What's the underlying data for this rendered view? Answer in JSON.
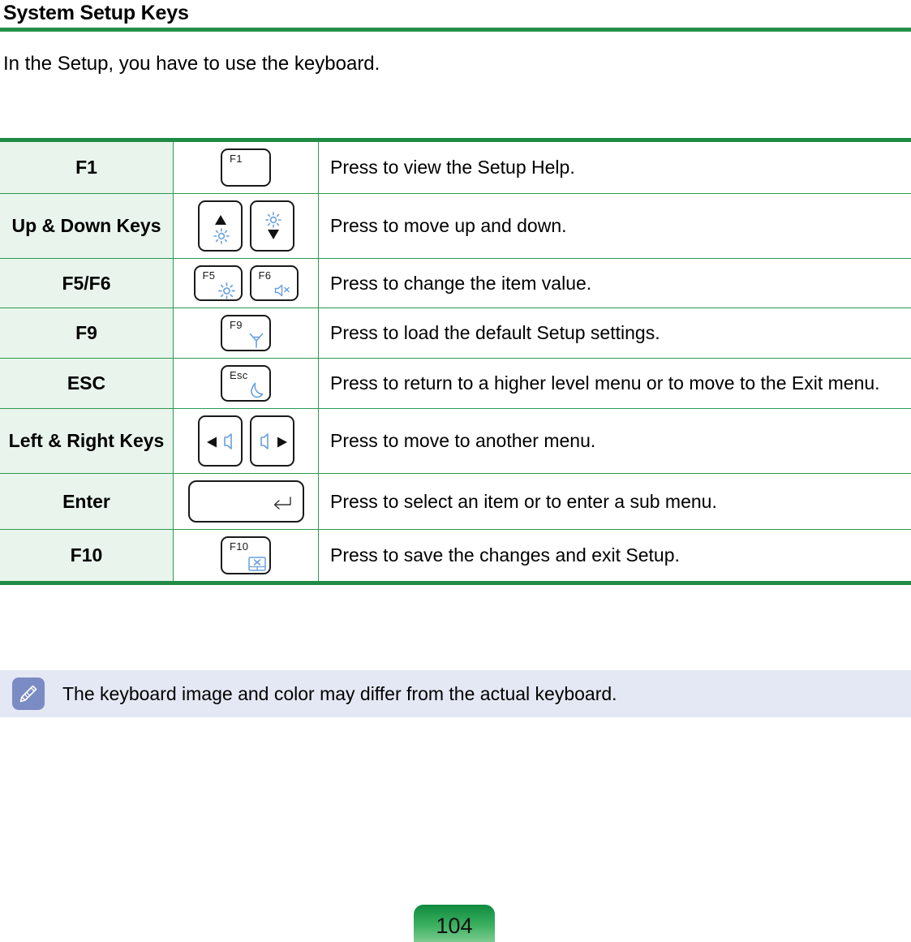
{
  "header": {
    "title": "System Setup Keys",
    "rule_color": "#239048"
  },
  "intro": {
    "text": "In the Setup, you have to use the keyboard."
  },
  "table": {
    "border_color": "#2c9a4f",
    "name_column_bg": "#e9f4ec",
    "rows": [
      {
        "name": "F1",
        "keycaps": [
          {
            "label": "F1",
            "glyph": "none"
          }
        ],
        "description": "Press to view the Setup Help."
      },
      {
        "name": "Up & Down Keys",
        "keycaps": [
          {
            "label": "",
            "glyph": "arrow-up-brightness-up"
          },
          {
            "label": "",
            "glyph": "arrow-down-brightness-down"
          }
        ],
        "description": "Press to move up and down."
      },
      {
        "name": "F5/F6",
        "keycaps": [
          {
            "label": "F5",
            "glyph": "brightness-icon"
          },
          {
            "label": "F6",
            "glyph": "speaker-mute-icon"
          }
        ],
        "description": "Press to change the item value."
      },
      {
        "name": "F9",
        "keycaps": [
          {
            "label": "F9",
            "glyph": "wireless-antenna-icon"
          }
        ],
        "description": "Press to load the default Setup settings."
      },
      {
        "name": "ESC",
        "keycaps": [
          {
            "label": "Esc",
            "glyph": "sleep-moon-icon"
          }
        ],
        "description": "Press to return to a higher level menu or to move to the Exit menu."
      },
      {
        "name": "Left & Right Keys",
        "keycaps": [
          {
            "label": "",
            "glyph": "arrow-left-volume-down"
          },
          {
            "label": "",
            "glyph": "arrow-right-volume-up"
          }
        ],
        "description": "Press to move to another menu."
      },
      {
        "name": "Enter",
        "keycaps": [
          {
            "label": "",
            "glyph": "enter-return-icon"
          }
        ],
        "description": "Press to select an item or to enter a sub menu."
      },
      {
        "name": "F10",
        "keycaps": [
          {
            "label": "F10",
            "glyph": "touchpad-off-icon"
          }
        ],
        "description": "Press to save the changes and exit Setup."
      }
    ]
  },
  "note": {
    "icon": "pencil-note-icon",
    "icon_bg": "#7b8bc4",
    "box_bg": "#e4e8f4",
    "text": "The keyboard image and color may differ from the actual keyboard."
  },
  "footer": {
    "page_number": "104"
  }
}
